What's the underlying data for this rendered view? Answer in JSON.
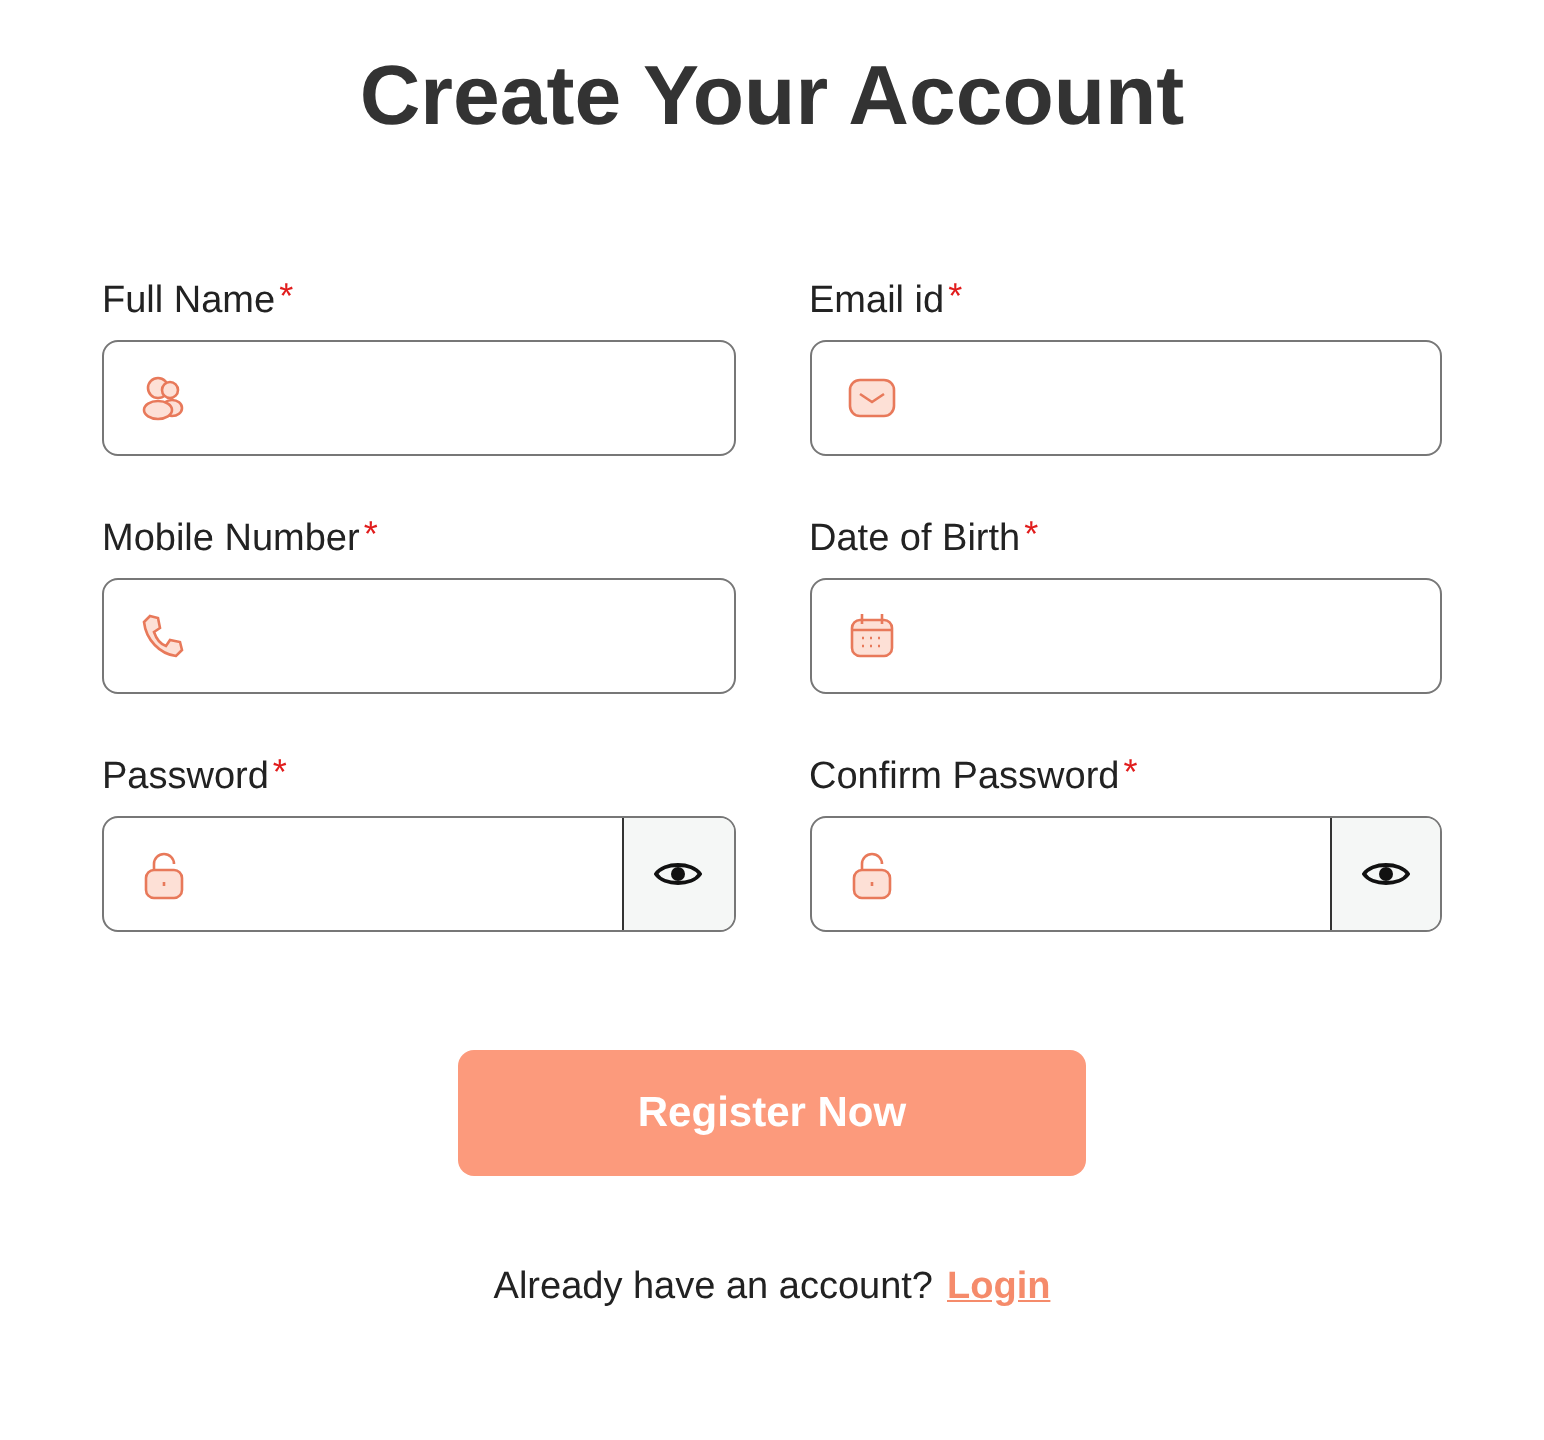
{
  "title": "Create Your Account",
  "fields": [
    {
      "label": "Full Name",
      "required_mark": "*",
      "kind": "person"
    },
    {
      "label": "Email id",
      "required_mark": "*",
      "kind": "email"
    },
    {
      "label": "Mobile Number",
      "required_mark": "*",
      "kind": "phone"
    },
    {
      "label": "Date of Birth",
      "required_mark": "*",
      "kind": "date"
    },
    {
      "label": "Password",
      "required_mark": "*",
      "kind": "password"
    },
    {
      "label": "Confirm Password",
      "required_mark": "*",
      "kind": "password"
    }
  ],
  "submit": "Register Now",
  "footer": {
    "text": "Already have an account?",
    "link": "Login"
  }
}
